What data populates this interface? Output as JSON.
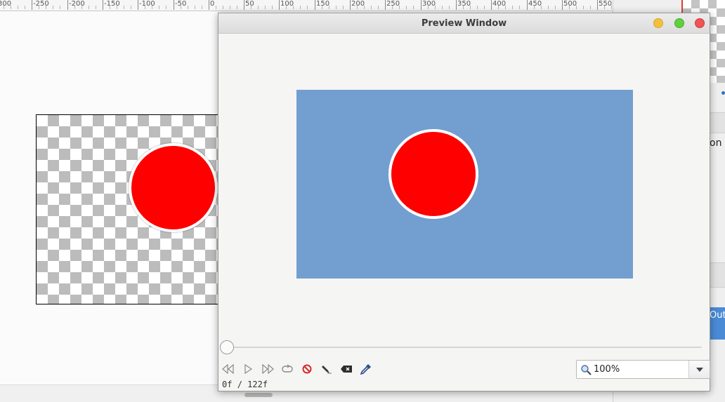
{
  "ruler": {
    "labels": [
      "300",
      "-250",
      "-200",
      "-150",
      "-100",
      "-50",
      "0",
      "50",
      "100",
      "150",
      "200",
      "250",
      "300",
      "350",
      "400",
      "450",
      "500",
      "550"
    ]
  },
  "preview": {
    "title": "Preview Window",
    "stage_color": "#729fcf",
    "circle_color": "#ff0000",
    "frame_current": "0f",
    "frame_separator": "/",
    "frame_total": "122f",
    "zoom": "100%",
    "controls": [
      "rewind-icon",
      "play-icon",
      "fast-forward-icon",
      "loop-icon",
      "stop-icon",
      "pen-icon",
      "erase-icon",
      "color-picker-icon"
    ]
  },
  "right_panel": {
    "partial_label": "on",
    "partial_button": "Out"
  },
  "colors": {
    "accent": "#4b8bd6",
    "close": "#f05454",
    "minimize": "#f4bf3a",
    "maximize": "#5ed13d"
  }
}
